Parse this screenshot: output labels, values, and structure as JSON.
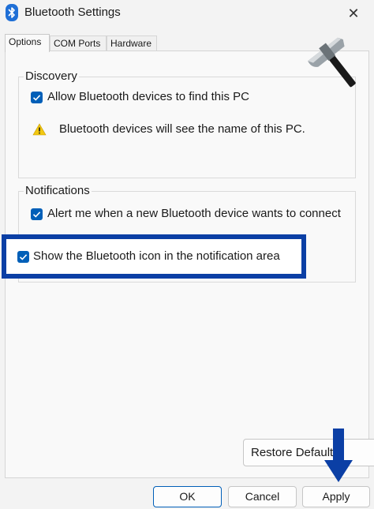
{
  "window": {
    "title": "Bluetooth Settings",
    "close_glyph": "✕",
    "icon": "bluetooth-icon"
  },
  "tabs": [
    {
      "label": "Options",
      "active": true
    },
    {
      "label": "COM Ports",
      "active": false
    },
    {
      "label": "Hardware",
      "active": false
    }
  ],
  "discovery": {
    "heading": "Discovery",
    "allow_label": "Allow Bluetooth devices to find this PC",
    "allow_checked": true,
    "warning_text": "Bluetooth devices will see the name of this PC.",
    "warning_icon": "warning-icon"
  },
  "notifications": {
    "heading": "Notifications",
    "alert_label": "Alert me when a new Bluetooth device wants to connect",
    "alert_checked": true
  },
  "show_icon": {
    "label": "Show the Bluetooth icon in the notification area",
    "checked": true
  },
  "buttons": {
    "restore": "Restore Defaults",
    "ok": "OK",
    "cancel": "Cancel",
    "apply": "Apply"
  },
  "colors": {
    "accent": "#005fb8",
    "highlight_border": "#0b3fa5",
    "arrow": "#0b3fa5",
    "warning": "#f2c811"
  }
}
